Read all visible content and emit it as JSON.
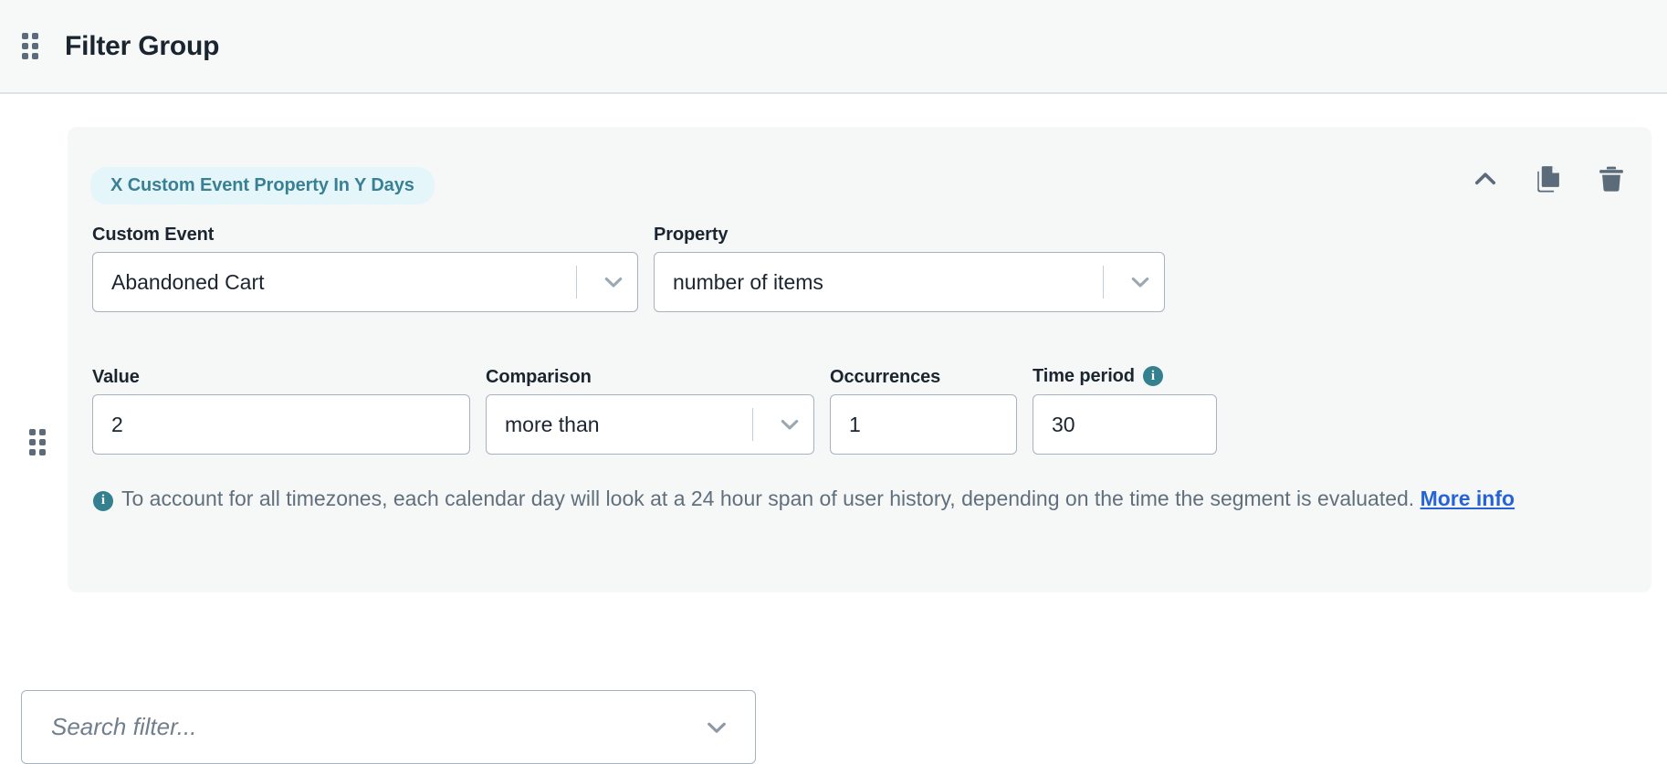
{
  "header": {
    "title": "Filter Group",
    "drag_handle_icon": "drag-grid-icon"
  },
  "filter_card": {
    "badge_label": "X Custom Event Property In Y Days",
    "actions": [
      {
        "name": "collapse-button",
        "icon": "chevron-up-icon",
        "label": "Collapse"
      },
      {
        "name": "duplicate-button",
        "icon": "copy-icon",
        "label": "Duplicate"
      },
      {
        "name": "delete-button",
        "icon": "trash-icon",
        "label": "Delete"
      }
    ],
    "fields": {
      "custom_event": {
        "label": "Custom Event",
        "value": "Abandoned Cart",
        "icon": "chevron-down-icon"
      },
      "property": {
        "label": "Property",
        "value": "number of items",
        "icon": "chevron-down-icon"
      },
      "value": {
        "label": "Value",
        "value": "2"
      },
      "comparison": {
        "label": "Comparison",
        "value": "more than",
        "icon": "chevron-down-icon"
      },
      "occurrences": {
        "label": "Occurrences",
        "value": "1"
      },
      "time_period": {
        "label": "Time period",
        "value": "30",
        "info_icon": "info-icon"
      }
    },
    "helper": {
      "icon": "info-icon",
      "text": "To account for all timezones, each calendar day will look at a 24 hour span of user history, depending on the time the segment is evaluated.",
      "link_label": "More info"
    }
  },
  "search_filter": {
    "placeholder": "Search filter...",
    "value": "",
    "icon": "chevron-down-icon"
  },
  "colors": {
    "badge_bg": "#e5f6fa",
    "badge_text": "#3a8095",
    "card_bg": "#f6f8f8",
    "header_bg": "#f7f9f9",
    "info_teal": "#35808f",
    "link_blue": "#2563d6",
    "border": "#a6b3bd",
    "text_dark": "#1b2530",
    "text_muted": "#616f7d"
  }
}
